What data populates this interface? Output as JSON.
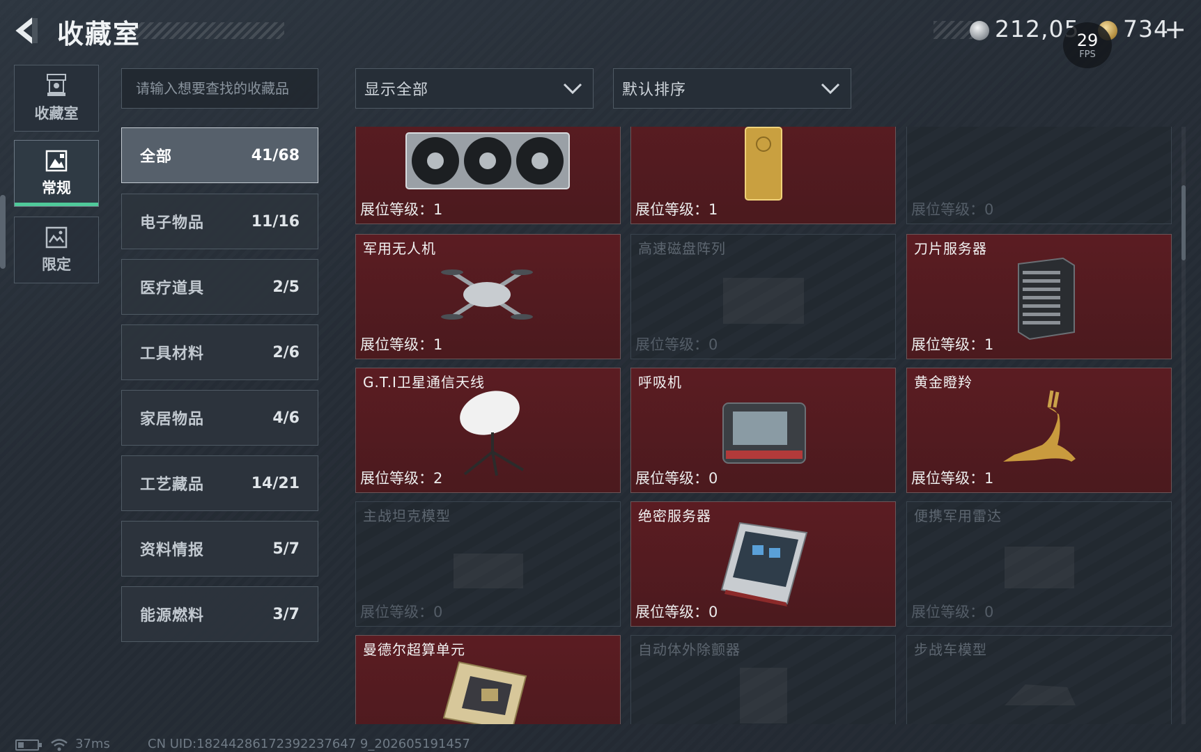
{
  "header": {
    "title": "收藏室",
    "currency": [
      {
        "icon": "silver-coin-icon",
        "value": "212,05"
      },
      {
        "icon": "gold-coin-icon",
        "value": "734"
      }
    ],
    "add_label": "+",
    "fps": {
      "value": "29",
      "label": "FPS"
    }
  },
  "sidebar": {
    "tabs": [
      {
        "label": "收藏室",
        "icon": "trophy-icon",
        "active": false
      },
      {
        "label": "常规",
        "icon": "image-icon",
        "active": true
      },
      {
        "label": "限定",
        "icon": "picture-icon",
        "active": false
      }
    ]
  },
  "search": {
    "placeholder": "请输入想要查找的收藏品"
  },
  "categories": [
    {
      "name": "全部",
      "count": "41/68",
      "active": true
    },
    {
      "name": "电子物品",
      "count": "11/16"
    },
    {
      "name": "医疗道具",
      "count": "2/5"
    },
    {
      "name": "工具材料",
      "count": "2/6"
    },
    {
      "name": "家居物品",
      "count": "4/6"
    },
    {
      "name": "工艺藏品",
      "count": "14/21"
    },
    {
      "name": "资料情报",
      "count": "5/7"
    },
    {
      "name": "能源燃料",
      "count": "3/7"
    }
  ],
  "filters": {
    "display": "显示全部",
    "sort": "默认排序"
  },
  "items": [
    {
      "name": "",
      "level": "展位等级：1",
      "unlocked": true,
      "icon": "graphics-card-icon"
    },
    {
      "name": "",
      "level": "展位等级：1",
      "unlocked": true,
      "icon": "gold-bar-icon"
    },
    {
      "name": "",
      "level": "展位等级：0",
      "unlocked": false,
      "icon": "unknown-icon"
    },
    {
      "name": "军用无人机",
      "level": "展位等级：1",
      "unlocked": true,
      "icon": "drone-icon"
    },
    {
      "name": "高速磁盘阵列",
      "level": "展位等级：0",
      "unlocked": false,
      "icon": "disk-array-icon"
    },
    {
      "name": "刀片服务器",
      "level": "展位等级：1",
      "unlocked": true,
      "icon": "blade-server-icon"
    },
    {
      "name": "G.T.I卫星通信天线",
      "level": "展位等级：2",
      "unlocked": true,
      "icon": "satellite-dish-icon"
    },
    {
      "name": "呼吸机",
      "level": "展位等级：0",
      "unlocked": true,
      "icon": "ventilator-icon"
    },
    {
      "name": "黄金瞪羚",
      "level": "展位等级：1",
      "unlocked": true,
      "icon": "golden-gazelle-icon"
    },
    {
      "name": "主战坦克模型",
      "level": "展位等级：0",
      "unlocked": false,
      "icon": "tank-model-icon"
    },
    {
      "name": "绝密服务器",
      "level": "展位等级：0",
      "unlocked": true,
      "icon": "rack-server-icon"
    },
    {
      "name": "便携军用雷达",
      "level": "展位等级：0",
      "unlocked": false,
      "icon": "radar-icon"
    },
    {
      "name": "曼德尔超算单元",
      "level": "",
      "unlocked": true,
      "icon": "compute-unit-icon"
    },
    {
      "name": "自动体外除颤器",
      "level": "",
      "unlocked": false,
      "icon": "defibrillator-icon"
    },
    {
      "name": "步战车模型",
      "level": "",
      "unlocked": false,
      "icon": "ifv-model-icon"
    }
  ],
  "footer": {
    "ping": "37ms",
    "uid": "CN UID:18244286172392237647 9_202605191457"
  }
}
